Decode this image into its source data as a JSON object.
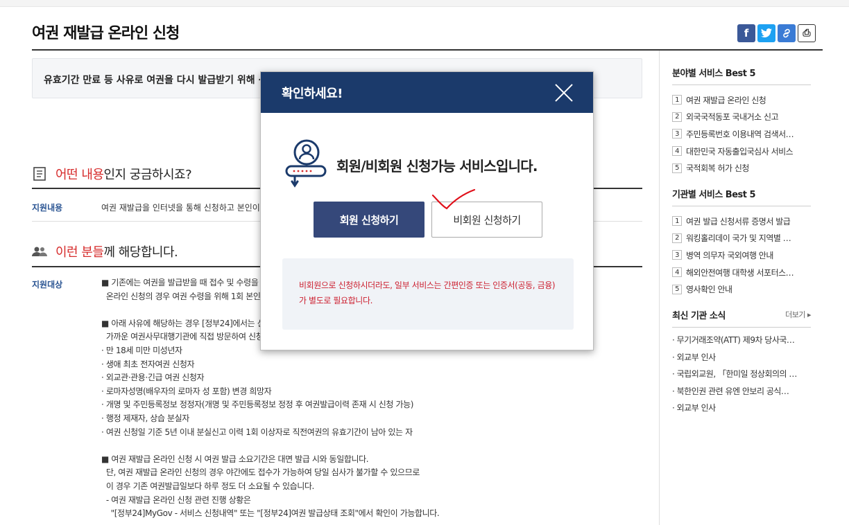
{
  "page": {
    "title": "여권 재발급 온라인 신청",
    "summary": "유효기간 만료 등 사유로 여권을 다시 발급받기 위해 신"
  },
  "share": {
    "facebook_glyph": "f",
    "twitter_glyph": "t",
    "link_glyph": "🔗",
    "print_glyph": "⎙"
  },
  "section1": {
    "head_red": "어떤 내용",
    "head_rest": "인지 궁금하시죠?",
    "row_label": "지원내용",
    "row_text": "여권 재발급을 인터넷을 통해 신청하고 본인이 지"
  },
  "section2": {
    "head_red": "이런 분들",
    "head_rest": "께 해당합니다.",
    "row_label": "지원대상",
    "lines": [
      "■ 기존에는 여권을 발급받을 때 접수 및 수령을 위",
      "  온라인 신청의 경우 여권 수령을 위해 1회 본인이",
      "",
      "■ 아래 사유에 해당하는 경우 [정부24]에서는 신",
      "  가까운 여권사무대행기관에 직접 방문하여 신청",
      "· 만 18세 미만 미성년자",
      "· 생애 최초 전자여권 신청자",
      "· 외교관·관용·긴급 여권 신청자",
      "· 로마자성명(배우자의 로마자 성 포함) 변경 희망자",
      "· 개명 및 주민등록정보 정정자(개명 및 주민등록정보 정정 후 여권발급이력 존재 시 신청 가능)",
      "· 행정 제재자, 상습 분실자",
      "· 여권 신청일 기준 5년 이내 분실신고 이력 1회 이상자로 직전여권의 유효기간이 남아 있는 자",
      "",
      "■ 여권 재발급 온라인 신청 시 여권 발급 소요기간은 대면 발급 시와 동일합니다.",
      "  단, 여권 재발급 온라인 신청의 경우 야간에도 접수가 가능하여 당일 심사가 불가할 수 있으므로",
      "  이 경우 기존 여권발급일보다 하루 정도 더 소요될 수 있습니다.",
      "  - 여권 재발급 온라인 신청 관련 진행 상황은",
      "    \"[정부24]MyGov - 서비스 신청내역\" 또는 \"[정부24]여권 발급상태 조회\"에서 확인이 가능합니다."
    ]
  },
  "sidebar": {
    "best_field": {
      "title": "분야별 서비스 Best 5",
      "items": [
        "여권 재발급 온라인 신청",
        "외국국적동포 국내거소 신고",
        "주민등록번호 이용내역 검색서…",
        "대한민국 자동출입국심사 서비스",
        "국적회복 허가 신청"
      ]
    },
    "best_agency": {
      "title": "기관별 서비스 Best 5",
      "items": [
        "여권 발급 신청서류 증명서 발급",
        "워킹홀리데이 국가 및 지역별 …",
        "병역 의무자 국외여행 안내",
        "해외안전여행 대학생 서포터스…",
        "영사확인 안내"
      ]
    },
    "news": {
      "title": "최신 기관 소식",
      "more": "더보기 ▸",
      "items": [
        "· 무기거래조약(ATT) 제9차 당사국…",
        "· 외교부 인사",
        "· 국립외교원, 「한미일 정상회의의 …",
        "· 북한인권 관련 유엔 안보리 공식…",
        "· 외교부 인사"
      ]
    }
  },
  "modal": {
    "title": "확인하세요!",
    "message": "회원/비회원 신청가능 서비스입니다.",
    "member_button": "회원 신청하기",
    "nonmember_button": "비회원 신청하기",
    "notice_line1": "비회원으로 신청하시더라도, 일부 서비스는 간편인증 또는 인증서(공동, 금융)",
    "notice_line2": "가 별도로 필요합니다."
  },
  "colors": {
    "modal_header": "#1b3a6b",
    "member_button": "#35487a",
    "accent_red": "#d62b2b",
    "label_blue": "#2b5593",
    "notice_red": "#cc1f2f"
  }
}
